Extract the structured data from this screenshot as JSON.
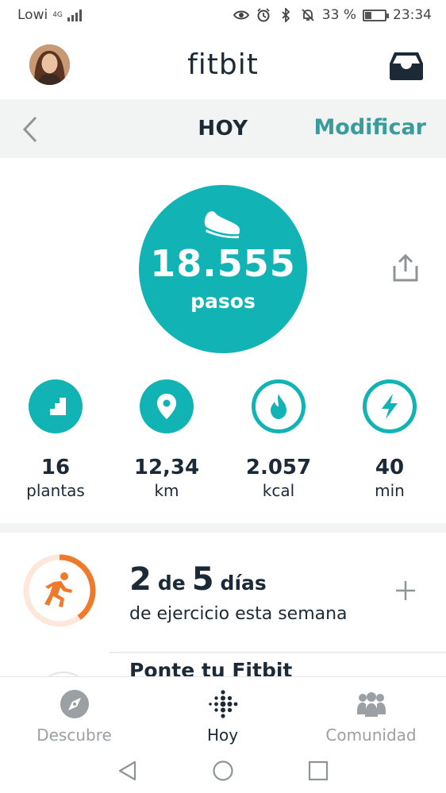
{
  "status_bar": {
    "carrier": "Lowi",
    "network": "4G",
    "battery_percent": "33 %",
    "battery_level": 0.33,
    "time": "23:34",
    "icons": [
      "eye-icon",
      "alarm-icon",
      "bluetooth-icon",
      "bell-off-icon",
      "battery-icon"
    ]
  },
  "header": {
    "logo": "fitbit",
    "avatar_icon": "avatar",
    "inbox_icon": "inbox-icon"
  },
  "date_bar": {
    "back_icon": "chevron-left-icon",
    "title": "HOY",
    "edit_label": "Modificar"
  },
  "steps": {
    "value": "18.555",
    "unit": "pasos",
    "icon": "shoe-icon",
    "share_icon": "share-icon"
  },
  "stats": [
    {
      "value": "16",
      "unit": "plantas",
      "icon": "stairs-icon"
    },
    {
      "value": "12,34",
      "unit": "km",
      "icon": "location-pin-icon"
    },
    {
      "value": "2.057",
      "unit": "kcal",
      "icon": "flame-icon"
    },
    {
      "value": "40",
      "unit": "min",
      "icon": "lightning-icon"
    }
  ],
  "exercise": {
    "done": "2",
    "of": "de",
    "goal": "5",
    "days": "días",
    "subtitle": "de ejercicio esta semana",
    "progress": 0.4,
    "icon": "runner-icon",
    "add_icon": "plus-icon"
  },
  "next_card": {
    "title": "Ponte tu Fitbit"
  },
  "bottom_nav": [
    {
      "label": "Descubre",
      "icon": "compass-icon",
      "active": false
    },
    {
      "label": "Hoy",
      "icon": "fitbit-dots-icon",
      "active": true
    },
    {
      "label": "Comunidad",
      "icon": "community-icon",
      "active": false
    }
  ],
  "system_nav": [
    "back-triangle-icon",
    "home-circle-icon",
    "recents-square-icon"
  ],
  "colors": {
    "accent": "#12b3b5",
    "link": "#3a9c9a",
    "exercise": "#f07a2c",
    "text": "#1b2a36"
  }
}
